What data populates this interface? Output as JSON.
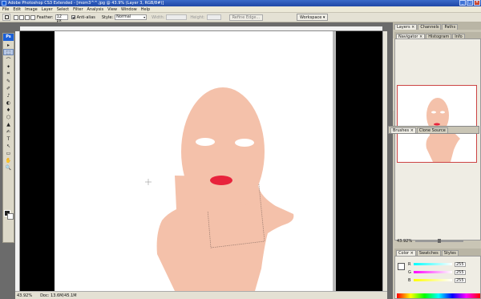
{
  "window": {
    "title": "Adobe Photoshop CS3 Extended - [mom3^^.jpg @ 43.9% (Layer 3, RGB/8#)]",
    "controls": [
      "_",
      "□",
      "✕"
    ]
  },
  "menu": [
    "File",
    "Edit",
    "Image",
    "Layer",
    "Select",
    "Filter",
    "Analysis",
    "View",
    "Window",
    "Help"
  ],
  "options": {
    "feather_label": "Feather:",
    "feather_value": "12 px",
    "antialias_label": "Anti-alias",
    "style_label": "Style:",
    "style_value": "Normal",
    "width_label": "Width:",
    "height_label": "Height:",
    "refine_edge": "Refine Edge...",
    "workspace": "Workspace ▾"
  },
  "tools": {
    "logo": "Ps",
    "glyphs": [
      "▸",
      "⬚",
      "⌒",
      "✦",
      "⌗",
      "✎",
      "✐",
      "♪",
      "◐",
      "♦",
      "⬡",
      "▲",
      "✍",
      "T",
      "↖",
      "▭",
      "✋",
      "🔍"
    ]
  },
  "status": {
    "zoom": "43.92%",
    "doc": "Doc: 13.6M/45.1M"
  },
  "panels": {
    "top_tabs": [
      "Layers ×",
      "Channels",
      "Paths"
    ],
    "nav_tabs": [
      "Navigator ×",
      "Histogram",
      "Info"
    ],
    "float_tabs": [
      "Brushes ×",
      "Clone Source"
    ],
    "nav_zoom": "43.92%",
    "color_tabs": [
      "Color ×",
      "Swatches",
      "Styles"
    ],
    "color": [
      {
        "label": "R",
        "value": "255"
      },
      {
        "label": "G",
        "value": "255"
      },
      {
        "label": "B",
        "value": "255"
      }
    ]
  },
  "colors": {
    "skin": "#f4c1aa",
    "lips": "#e8233c",
    "photo_bg": "#ffffff"
  }
}
